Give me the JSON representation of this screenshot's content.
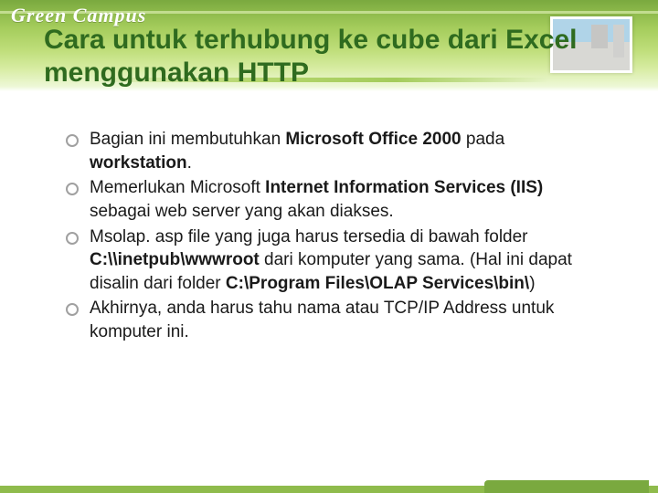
{
  "brand": "Green Campus",
  "title": "Cara untuk terhubung ke cube dari Excel menggunakan HTTP",
  "bullets": [
    {
      "pre": "Bagian ini membutuhkan ",
      "bold1": "Microsoft Office 2000",
      "mid1": " pada ",
      "bold2": "workstation",
      "mid2": ".",
      "bold3": "",
      "mid3": "",
      "bold4": "",
      "tail": ""
    },
    {
      "pre": "Memerlukan Microsoft ",
      "bold1": "Internet Information Services (IIS)",
      "mid1": " sebagai web server yang akan diakses.",
      "bold2": "",
      "mid2": "",
      "bold3": "",
      "mid3": "",
      "bold4": "",
      "tail": ""
    },
    {
      "pre": " Msolap. asp file yang juga harus tersedia di bawah folder ",
      "bold1": "C:\\\\inetpub\\wwwroot",
      "mid1": " dari komputer yang sama. (Hal ini dapat disalin dari folder ",
      "bold2": "C:\\Program Files\\OLAP Services\\bin\\",
      "mid2": ")",
      "bold3": "",
      "mid3": "",
      "bold4": "",
      "tail": ""
    },
    {
      "pre": "Akhirnya, anda harus tahu nama atau TCP/IP Address untuk komputer ini.",
      "bold1": "",
      "mid1": "",
      "bold2": "",
      "mid2": "",
      "bold3": "",
      "mid3": "",
      "bold4": "",
      "tail": ""
    }
  ]
}
